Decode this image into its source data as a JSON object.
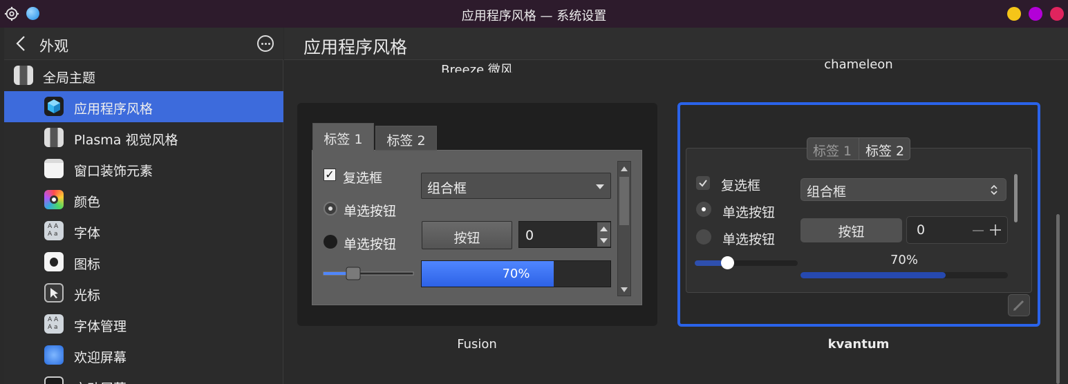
{
  "window": {
    "title": "应用程序风格 — 系统设置"
  },
  "sidebar": {
    "header_title": "外观",
    "items": [
      {
        "label": "全局主题",
        "icon": "tuxedo-icon"
      },
      {
        "label": "应用程序风格",
        "icon": "cube-icon",
        "active": true
      },
      {
        "label": "Plasma 视觉风格",
        "icon": "tuxedo-icon"
      },
      {
        "label": "窗口装饰元素",
        "icon": "window-icon"
      },
      {
        "label": "颜色",
        "icon": "color-palette-icon"
      },
      {
        "label": "字体",
        "icon": "font-icon"
      },
      {
        "label": "图标",
        "icon": "apple-icon"
      },
      {
        "label": "光标",
        "icon": "cursor-icon"
      },
      {
        "label": "字体管理",
        "icon": "font-manager-icon"
      },
      {
        "label": "欢迎屏幕",
        "icon": "splash-icon"
      },
      {
        "label": "启动屏幕",
        "icon": "terminal-icon"
      }
    ]
  },
  "main": {
    "title": "应用程序风格",
    "top_names": [
      "Breeze 微风",
      "chameleon"
    ],
    "themes": [
      {
        "name": "Fusion",
        "tabs": [
          "标签 1",
          "标签 2"
        ],
        "checkbox_label": "复选框",
        "radio_labels": [
          "单选按钮",
          "单选按钮"
        ],
        "combo_label": "组合框",
        "button_label": "按钮",
        "spin_value": "0",
        "progress_label": "70%",
        "progress": 0.7
      },
      {
        "name": "kvantum",
        "selected": true,
        "tabs": [
          "标签 1",
          "标签 2"
        ],
        "checkbox_label": "复选框",
        "radio_labels": [
          "单选按钮",
          "单选按钮"
        ],
        "combo_label": "组合框",
        "button_label": "按钮",
        "spin_value": "0",
        "progress_label": "70%",
        "progress": 0.7
      }
    ]
  },
  "colors": {
    "accent": "#3d6bdc",
    "selection_border": "#2a63ea",
    "window_yellow": "#f5c518",
    "window_purple": "#b300d8",
    "window_red": "#e0245e"
  }
}
